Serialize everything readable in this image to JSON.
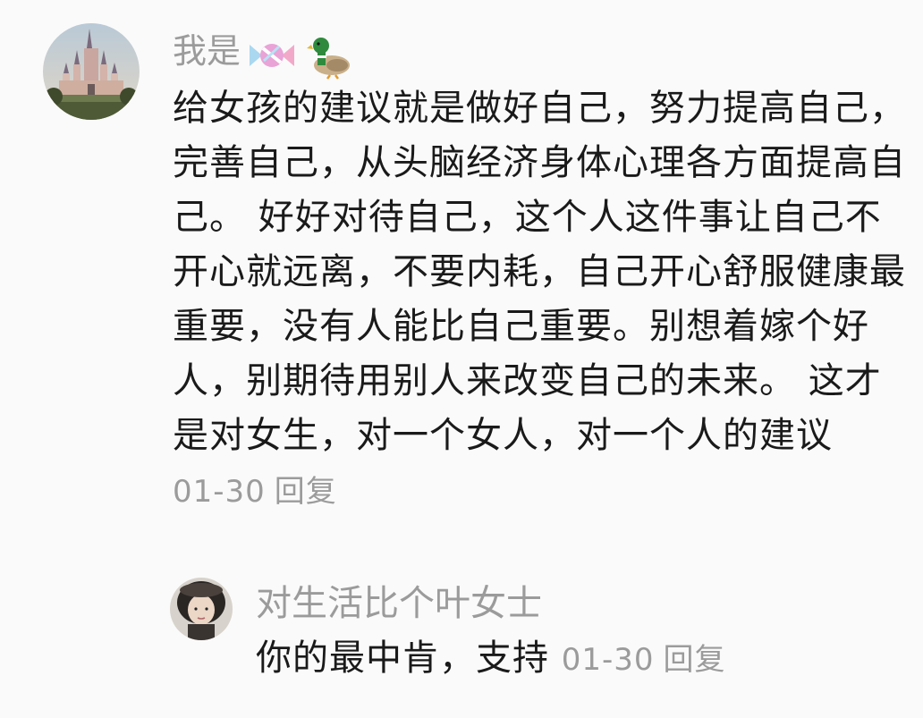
{
  "comments": [
    {
      "username": "我是",
      "username_emojis": [
        "candy-icon",
        "duck-icon"
      ],
      "text": "给女孩的建议就是做好自己，努力提高自己，完善自己，从头脑经济身体心理各方面提高自己。 好好对待自己，这个人这件事让自己不开心就远离，不要内耗，自己开心舒服健康最重要，没有人能比自己重要。别想着嫁个好人，别期待用别人来改变自己的未来。 这才是对女生，对一个女人，对一个人的建议",
      "date": "01-30",
      "reply_label": "回复"
    },
    {
      "username": "对生活比个叶女士",
      "text": "你的最中肯，支持",
      "date": "01-30",
      "reply_label": "回复"
    }
  ],
  "colors": {
    "background": "#fafafa",
    "text": "#1a1a1a",
    "muted": "#9b9b9b"
  }
}
